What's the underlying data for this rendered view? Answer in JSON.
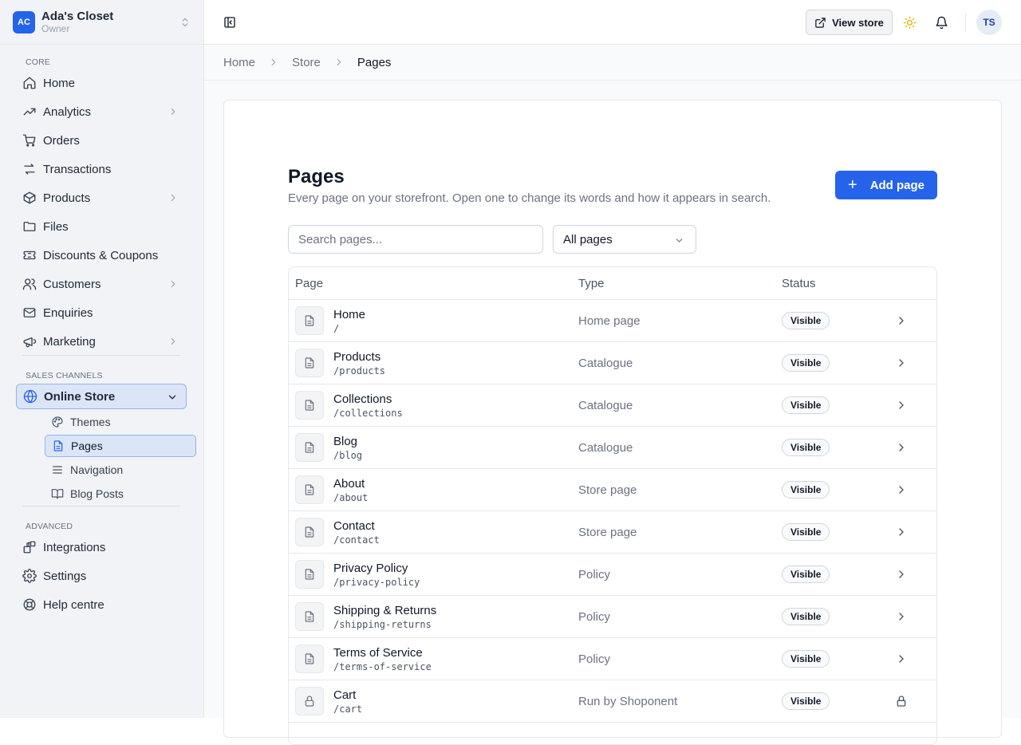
{
  "store": {
    "initials": "AC",
    "name": "Ada's Closet",
    "role": "Owner"
  },
  "sidebar": {
    "sections": {
      "core": "CORE",
      "sales": "SALES CHANNELS",
      "advanced": "ADVANCED"
    },
    "core_items": [
      {
        "label": "Home",
        "icon": "home-icon",
        "chevron": false
      },
      {
        "label": "Analytics",
        "icon": "trending-up-icon",
        "chevron": true
      },
      {
        "label": "Orders",
        "icon": "cart-icon",
        "chevron": false
      },
      {
        "label": "Transactions",
        "icon": "arrows-exchange-icon",
        "chevron": false
      },
      {
        "label": "Products",
        "icon": "box-icon",
        "chevron": true
      },
      {
        "label": "Files",
        "icon": "folder-icon",
        "chevron": false
      },
      {
        "label": "Discounts & Coupons",
        "icon": "ticket-icon",
        "chevron": false
      },
      {
        "label": "Customers",
        "icon": "users-icon",
        "chevron": true
      },
      {
        "label": "Enquiries",
        "icon": "mail-icon",
        "chevron": false
      },
      {
        "label": "Marketing",
        "icon": "megaphone-icon",
        "chevron": true
      }
    ],
    "online_store": {
      "label": "Online Store",
      "icon": "globe-icon"
    },
    "sub_items": [
      {
        "label": "Themes",
        "icon": "palette-icon"
      },
      {
        "label": "Pages",
        "icon": "document-icon"
      },
      {
        "label": "Navigation",
        "icon": "menu-icon"
      },
      {
        "label": "Blog Posts",
        "icon": "book-icon"
      }
    ],
    "advanced_items": [
      {
        "label": "Integrations",
        "icon": "blocks-icon"
      },
      {
        "label": "Settings",
        "icon": "gear-icon"
      },
      {
        "label": "Help centre",
        "icon": "lifebuoy-icon"
      }
    ]
  },
  "topbar": {
    "view_store": "View store",
    "avatar": "TS"
  },
  "breadcrumb": {
    "items": [
      "Home",
      "Store",
      "Pages"
    ]
  },
  "page": {
    "title": "Pages",
    "subtitle": "Every page on your storefront. Open one to change its words and how it appears in search.",
    "add_button": "Add page",
    "search_placeholder": "Search pages...",
    "filter_value": "All pages"
  },
  "table": {
    "headers": {
      "page": "Page",
      "type": "Type",
      "status": "Status"
    },
    "rows": [
      {
        "name": "Home",
        "path": "/",
        "type": "Home page",
        "status": "Visible",
        "locked": false
      },
      {
        "name": "Products",
        "path": "/products",
        "type": "Catalogue",
        "status": "Visible",
        "locked": false
      },
      {
        "name": "Collections",
        "path": "/collections",
        "type": "Catalogue",
        "status": "Visible",
        "locked": false
      },
      {
        "name": "Blog",
        "path": "/blog",
        "type": "Catalogue",
        "status": "Visible",
        "locked": false
      },
      {
        "name": "About",
        "path": "/about",
        "type": "Store page",
        "status": "Visible",
        "locked": false
      },
      {
        "name": "Contact",
        "path": "/contact",
        "type": "Store page",
        "status": "Visible",
        "locked": false
      },
      {
        "name": "Privacy Policy",
        "path": "/privacy-policy",
        "type": "Policy",
        "status": "Visible",
        "locked": false
      },
      {
        "name": "Shipping & Returns",
        "path": "/shipping-returns",
        "type": "Policy",
        "status": "Visible",
        "locked": false
      },
      {
        "name": "Terms of Service",
        "path": "/terms-of-service",
        "type": "Policy",
        "status": "Visible",
        "locked": false
      },
      {
        "name": "Cart",
        "path": "/cart",
        "type": "Run by Shoponent",
        "status": "Visible",
        "locked": true
      }
    ]
  }
}
